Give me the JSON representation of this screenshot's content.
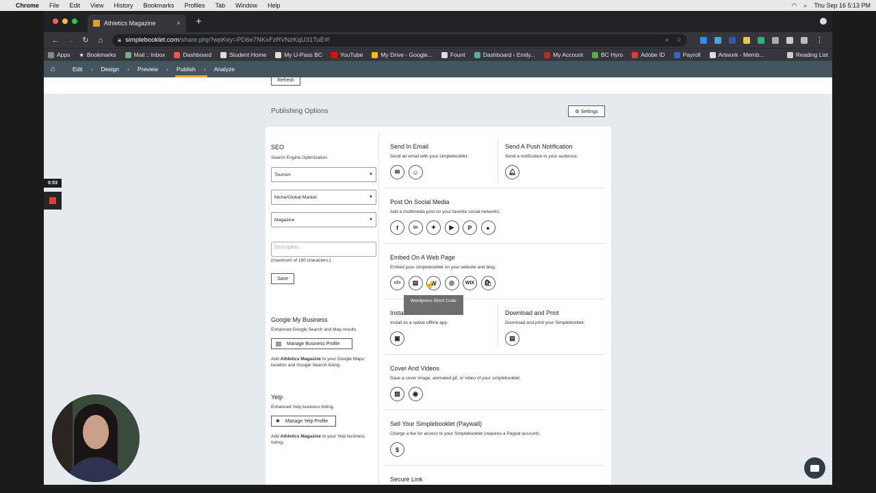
{
  "menubar": {
    "app": "Chrome",
    "items": [
      "File",
      "Edit",
      "View",
      "History",
      "Bookmarks",
      "Profiles",
      "Tab",
      "Window",
      "Help"
    ],
    "clock": "Thu Sep 16  5:13 PM"
  },
  "browser": {
    "tab_title": "Athletics Magazine",
    "url_domain": "simplebooklet.com",
    "url_path": "/share.php?wpKey=PD6e7NKxFzRVNzKqU31TuE#!",
    "bookmarks": [
      "Apps",
      "Bookmarks",
      "Mail :: Inbox",
      "Dashboard",
      "Student Home",
      "My U-Pass BC",
      "YouTube",
      "My Drive - Google...",
      "Fount",
      "Dashboard ‹ Emily...",
      "My Account",
      "BC Hyro",
      "Adobe ID",
      "Payroll",
      "Artwork - Memb..."
    ],
    "reading_list": "Reading List"
  },
  "nav": {
    "steps": [
      "Edit",
      "Design",
      "Preview",
      "Publish",
      "Analyze"
    ],
    "active": "Publish"
  },
  "top": {
    "refresh": "Refresh"
  },
  "publishing": {
    "title": "Publishing Options",
    "settings": "⚙ Settings"
  },
  "seo": {
    "title": "SEO",
    "subtitle": "Search Engine Optimization.",
    "select1": "Tourism",
    "select2": "Niche/Global Market",
    "select3": "Magazine",
    "desc_placeholder": "Description...",
    "note": "(maximum of 160 characters.)",
    "save": "Save"
  },
  "gmb": {
    "title": "Google My Business",
    "subtitle": "Enhanced Google Search and Map results.",
    "button": "Manage Business Profile",
    "text_pre": "Add ",
    "text_bold": "Athletics Magazine",
    "text_post": " to your Google Maps location and Google Search listing."
  },
  "yelp": {
    "title": "Yelp",
    "subtitle": "Enhanced Yelp business listing.",
    "button": "Manage Yelp Profile",
    "text_pre": "Add ",
    "text_bold": "Athletics Magazine",
    "text_post": " to your Yelp business listing."
  },
  "sections": {
    "email": {
      "title": "Send In Email",
      "desc": "Send an email with your simplebooklet."
    },
    "push": {
      "title": "Send A Push Notification",
      "desc": "Send a notification to your audience."
    },
    "social": {
      "title": "Post On Social Media",
      "desc": "Add a multimedia post on your favorite social networks."
    },
    "embed": {
      "title": "Embed On A Web Page",
      "desc": "Embed your simplebooklet on your website and blog.",
      "wix": "WIX"
    },
    "install": {
      "title": "Install",
      "desc": "Install as a native offline app."
    },
    "download": {
      "title": "Download and Print",
      "desc": "Download and print your Simplebooklet."
    },
    "cover": {
      "title": "Cover And Videos",
      "desc": "Save a cover image, animated gif, or video of your simplebooklet."
    },
    "sell": {
      "title": "Sell Your Simplebooklet (Paywall)",
      "desc": "Charge a fee for access to your Simplebooklet (requires a Paypal account)."
    },
    "secure": {
      "title": "Secure Link"
    }
  },
  "tooltip": "Wordpress Short Code",
  "recorder": {
    "timer": "0:53"
  }
}
